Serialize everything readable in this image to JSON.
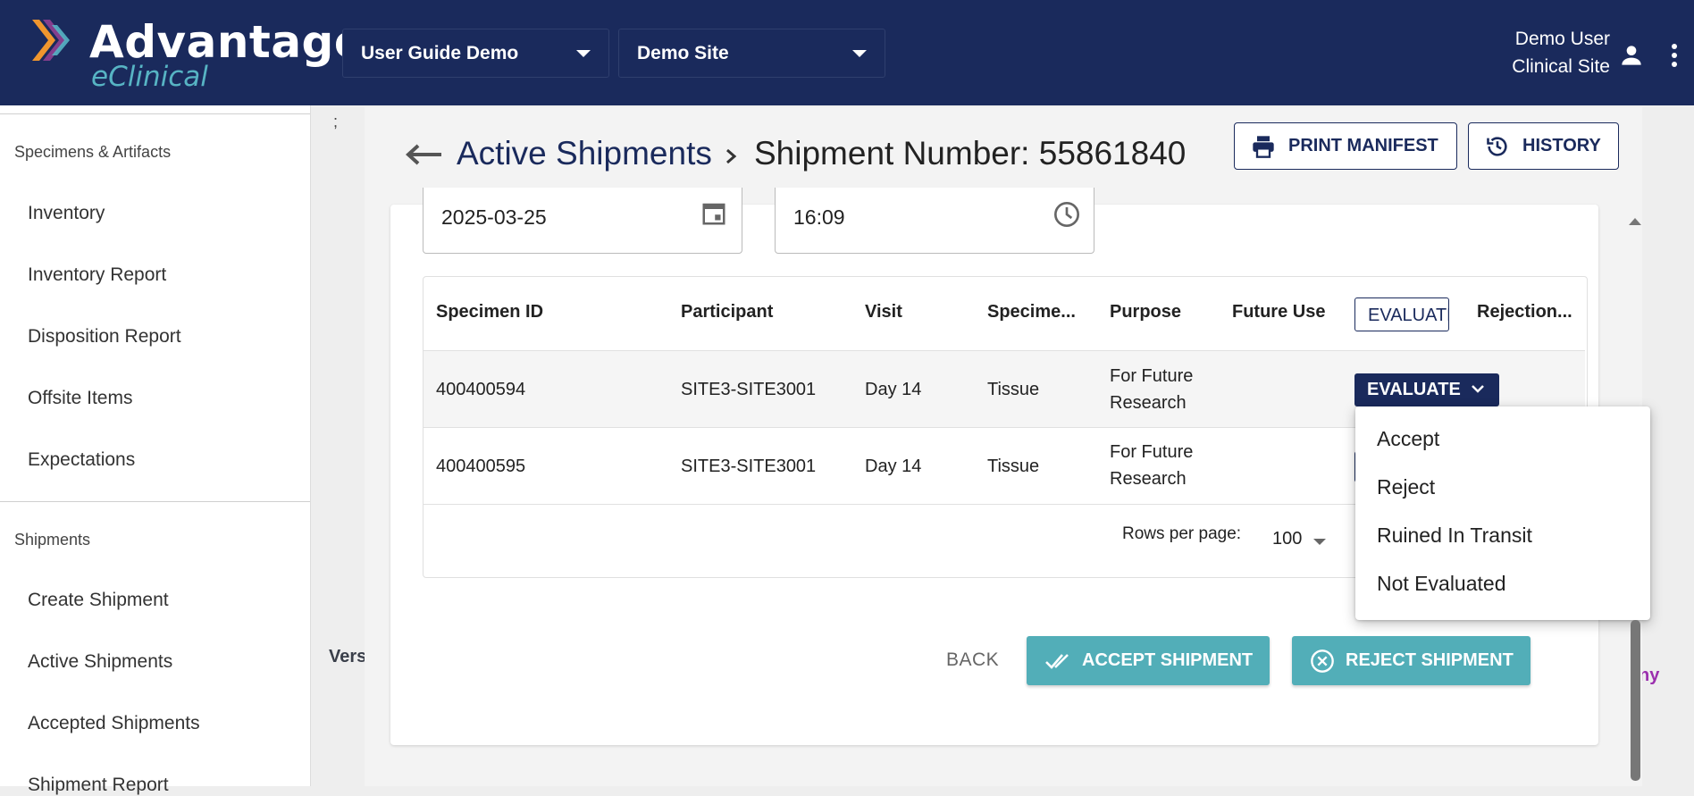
{
  "brand": {
    "title": "Advantage",
    "subtitle": "eClinical"
  },
  "header": {
    "study_selector": "User Guide Demo",
    "site_selector": "Demo Site",
    "user_name": "Demo User",
    "user_site": "Clinical Site"
  },
  "sidebar": {
    "sections": [
      {
        "header": "Specimens & Artifacts",
        "items": [
          "Inventory",
          "Inventory Report",
          "Disposition Report",
          "Offsite Items",
          "Expectations"
        ]
      },
      {
        "header": "Shipments",
        "items": [
          "Create Shipment",
          "Active Shipments",
          "Accepted Shipments",
          "Shipment Report"
        ]
      }
    ]
  },
  "background": {
    "semicolon": ";",
    "version_text": "Vers",
    "purple_text": "ny"
  },
  "breadcrumb": {
    "link": "Active Shipments",
    "current": "Shipment Number: 55861840"
  },
  "actions": {
    "print_manifest": "PRINT MANIFEST",
    "history": "HISTORY"
  },
  "form": {
    "date": "2025-03-25",
    "time": "16:09"
  },
  "table": {
    "columns": [
      "Specimen ID",
      "Participant",
      "Visit",
      "Specime...",
      "Purpose",
      "Future Use",
      "EVALUATE",
      "Rejection..."
    ],
    "rows": [
      {
        "specimen_id": "400400594",
        "participant": "SITE3-SITE3001",
        "visit": "Day 14",
        "specimen": "Tissue",
        "purpose_line1": "For Future",
        "purpose_line2": "Research",
        "future_use": "",
        "evaluate": "EVALUATE"
      },
      {
        "specimen_id": "400400595",
        "participant": "SITE3-SITE3001",
        "visit": "Day 14",
        "specimen": "Tissue",
        "purpose_line1": "For Future",
        "purpose_line2": "Research",
        "future_use": "",
        "evaluate": ""
      }
    ],
    "rows_per_page_label": "Rows per page:",
    "rows_per_page_value": "100"
  },
  "evaluate_menu": {
    "options": [
      "Accept",
      "Reject",
      "Ruined In Transit",
      "Not Evaluated"
    ]
  },
  "footer_buttons": {
    "back": "BACK",
    "accept": "ACCEPT SHIPMENT",
    "reject": "REJECT SHIPMENT"
  },
  "colors": {
    "navy": "#1a2a5c",
    "teal": "#52aeb8",
    "logo_teal": "#57b4c4",
    "logo_orange": "#f0962e",
    "logo_purple": "#8a3f8f"
  },
  "icons": [
    "logo-chevron-icon",
    "caret-down-icon",
    "person-icon",
    "more-vert-icon",
    "arrow-left-icon",
    "chevron-right-icon",
    "printer-icon",
    "history-icon",
    "calendar-icon",
    "clock-icon",
    "double-check-icon",
    "cancel-circle-icon"
  ]
}
